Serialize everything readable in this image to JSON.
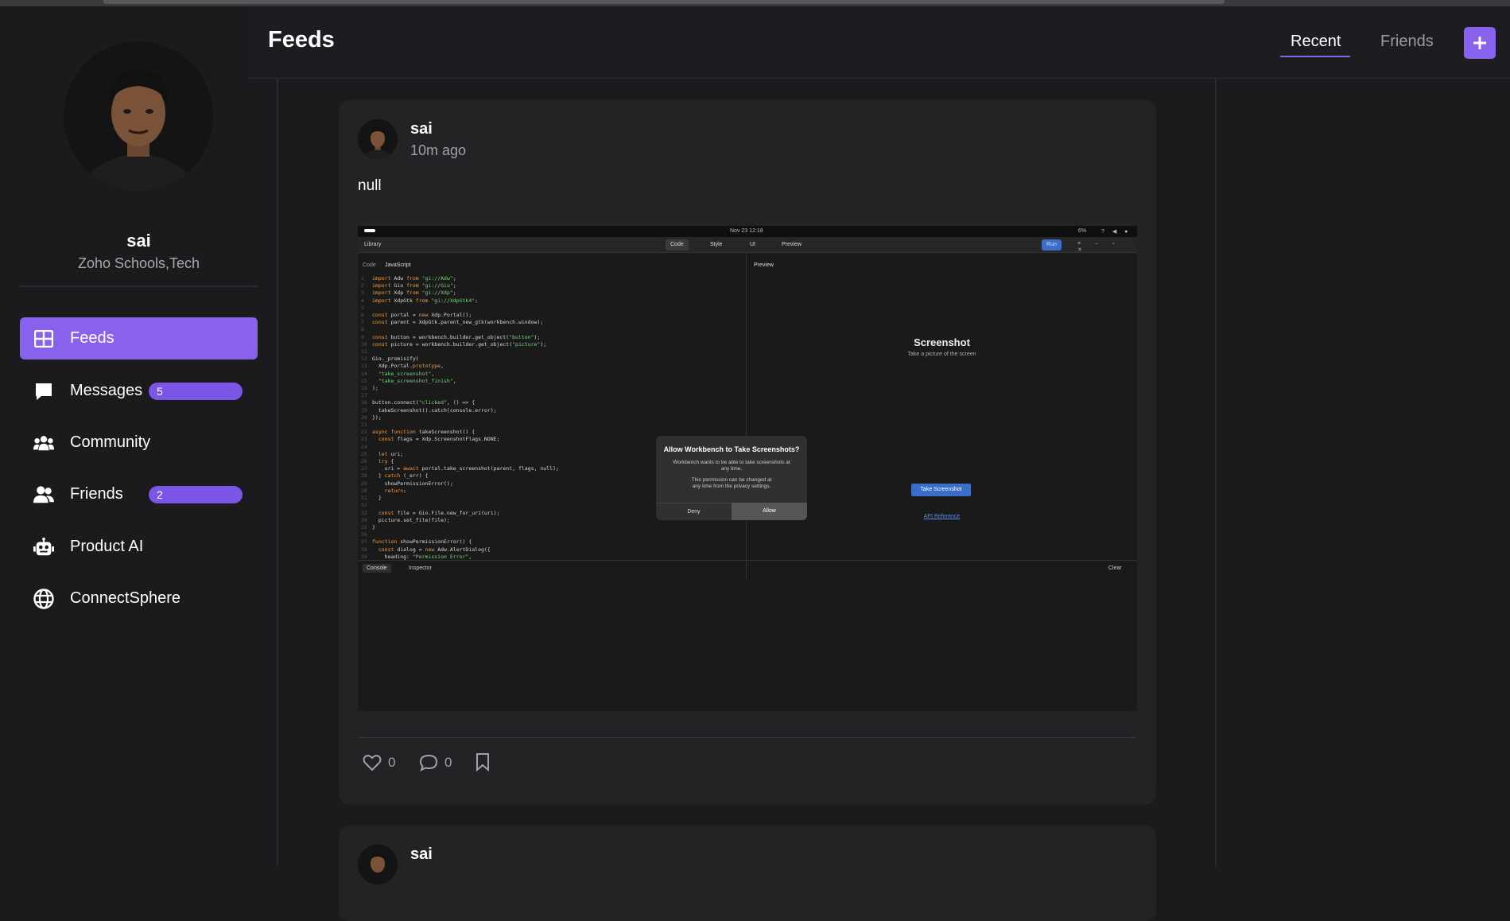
{
  "sidebar": {
    "profile": {
      "name": "sai",
      "org": "Zoho Schools,Tech"
    },
    "items": [
      {
        "label": "Feeds",
        "icon": "grid-icon",
        "active": true,
        "badge": null
      },
      {
        "label": "Messages",
        "icon": "chat-bubble-icon",
        "active": false,
        "badge": "5"
      },
      {
        "label": "Community",
        "icon": "community-icon",
        "active": false,
        "badge": null
      },
      {
        "label": "Friends",
        "icon": "friends-icon",
        "active": false,
        "badge": "2"
      },
      {
        "label": "Product AI",
        "icon": "robot-icon",
        "active": false,
        "badge": null
      },
      {
        "label": "ConnectSphere",
        "icon": "globe-icon",
        "active": false,
        "badge": null
      }
    ]
  },
  "header": {
    "title": "Feeds",
    "tabs": [
      {
        "label": "Recent",
        "active": true
      },
      {
        "label": "Friends",
        "active": false
      }
    ],
    "add_icon": "plus-icon"
  },
  "posts": [
    {
      "author": "sai",
      "time": "10m ago",
      "body": "null",
      "likes": "0",
      "comments": "0",
      "screenshot": {
        "clock": "Nov 23  12:18",
        "battery": "6%",
        "library": "Library",
        "tabs": [
          "Code",
          "Style",
          "UI",
          "Preview"
        ],
        "run": "Run",
        "code_label": "Code",
        "language": "JavaScript",
        "preview_label": "Preview",
        "preview_title": "Screenshot",
        "preview_subtitle": "Take a picture of the screen",
        "preview_button": "Take Screenshot",
        "preview_link": "API Reference",
        "dialog": {
          "title": "Allow Workbench to Take Screenshots?",
          "text1": "Workbench wants to be able to take screenshots at any time.",
          "text2": "This permission can be changed at any time from the privacy settings.",
          "deny": "Deny",
          "allow": "Allow"
        },
        "console_tab": "Console",
        "inspector_tab": "Inspector",
        "clear": "Clear"
      }
    },
    {
      "author": "sai"
    }
  ],
  "colors": {
    "accent": "#8862ec",
    "background": "#1b1b1d",
    "card": "#232326"
  }
}
